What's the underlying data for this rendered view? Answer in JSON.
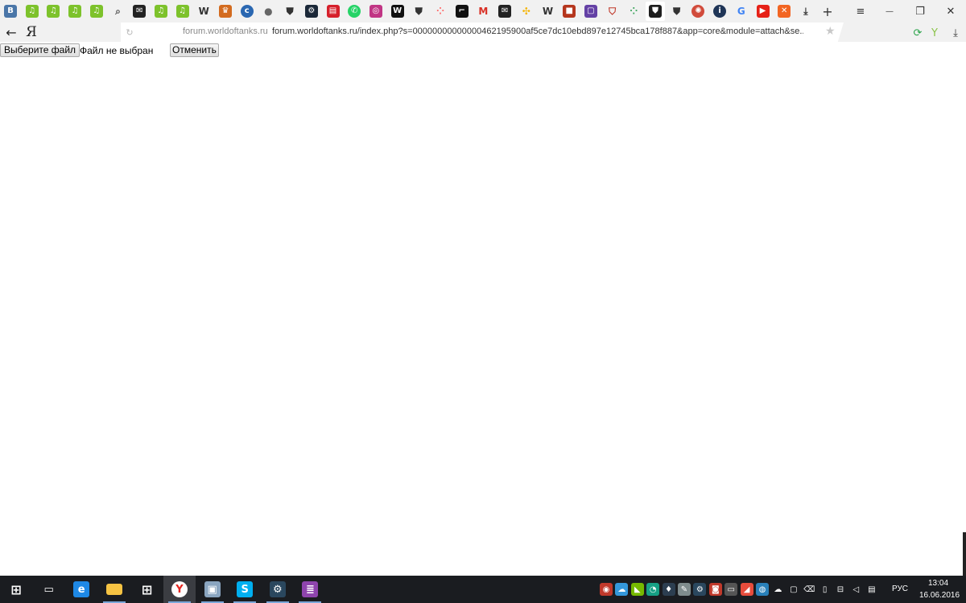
{
  "browser": {
    "tabs": [
      {
        "name": "tab-vk",
        "icon": "vk-icon",
        "glyph": "B",
        "color": "#4a76a8",
        "round": false
      },
      {
        "name": "tab-music-1",
        "icon": "music-note-icon",
        "glyph": "♫",
        "color": "#7dc22b",
        "round": false
      },
      {
        "name": "tab-music-2",
        "icon": "music-note-icon",
        "glyph": "♫",
        "color": "#7dc22b",
        "round": false
      },
      {
        "name": "tab-music-3",
        "icon": "music-note-icon",
        "glyph": "♫",
        "color": "#7dc22b",
        "round": false
      },
      {
        "name": "tab-music-4",
        "icon": "music-note-icon",
        "glyph": "♫",
        "color": "#7dc22b",
        "round": false
      },
      {
        "name": "tab-search",
        "icon": "search-icon",
        "glyph": "⌕",
        "color": "#555555",
        "plain": true
      },
      {
        "name": "tab-mail-1",
        "icon": "envelope-icon",
        "glyph": "✉",
        "color": "#222222",
        "round": false
      },
      {
        "name": "tab-music-5",
        "icon": "music-note-icon",
        "glyph": "♫",
        "color": "#7dc22b",
        "round": false
      },
      {
        "name": "tab-music-6",
        "icon": "music-note-icon",
        "glyph": "♫",
        "color": "#7dc22b",
        "round": false
      },
      {
        "name": "tab-wikipedia-1",
        "icon": "wikipedia-icon",
        "glyph": "W",
        "color": "#333333",
        "plain": true
      },
      {
        "name": "tab-game-shield",
        "icon": "shield-icon",
        "glyph": "♛",
        "color": "#d36b1f",
        "round": false
      },
      {
        "name": "tab-ct",
        "icon": "ct-icon",
        "glyph": "c",
        "color": "#2a67b1",
        "round": true
      },
      {
        "name": "tab-apple",
        "icon": "apple-icon",
        "glyph": "●",
        "color": "#666666",
        "plain": true
      },
      {
        "name": "tab-wot-1",
        "icon": "tank-icon",
        "glyph": "⛊",
        "color": "#333333",
        "plain": true
      },
      {
        "name": "tab-steam",
        "icon": "steam-icon",
        "glyph": "⚙",
        "color": "#1b2838",
        "round": false
      },
      {
        "name": "tab-red-logo",
        "icon": "video-icon",
        "glyph": "▤",
        "color": "#d6202b",
        "round": false
      },
      {
        "name": "tab-whatsapp",
        "icon": "whatsapp-icon",
        "glyph": "✆",
        "color": "#25d366",
        "round": true
      },
      {
        "name": "tab-instagram",
        "icon": "instagram-icon",
        "glyph": "◎",
        "color": "#c13584",
        "round": false
      },
      {
        "name": "tab-wikipedia-2",
        "icon": "wikipedia-icon",
        "glyph": "W",
        "color": "#111111",
        "round": false
      },
      {
        "name": "tab-wot-2",
        "icon": "tank-icon",
        "glyph": "⛊",
        "color": "#333333",
        "plain": true
      },
      {
        "name": "tab-dots",
        "icon": "dots-icon",
        "glyph": "⁘",
        "color": "#ff6b6b",
        "plain": true
      },
      {
        "name": "tab-dark-app",
        "icon": "app-icon",
        "glyph": "⌐",
        "color": "#111111",
        "round": false
      },
      {
        "name": "tab-gmail",
        "icon": "gmail-icon",
        "glyph": "M",
        "color": "#d93025",
        "plain": true
      },
      {
        "name": "tab-mail-2",
        "icon": "envelope-icon",
        "glyph": "✉",
        "color": "#222222",
        "round": false
      },
      {
        "name": "tab-photos",
        "icon": "pinwheel-icon",
        "glyph": "✣",
        "color": "#f4b400",
        "plain": true
      },
      {
        "name": "tab-wikipedia-3",
        "icon": "wikipedia-icon",
        "glyph": "W",
        "color": "#333333",
        "plain": true
      },
      {
        "name": "tab-red-square",
        "icon": "game-icon",
        "glyph": "■",
        "color": "#b5361d",
        "round": false
      },
      {
        "name": "tab-twitch",
        "icon": "twitch-icon",
        "glyph": "▢",
        "color": "#6441a5",
        "round": false
      },
      {
        "name": "tab-shield-red",
        "icon": "shield-icon",
        "glyph": "⛉",
        "color": "#c0392b",
        "plain": true
      },
      {
        "name": "tab-dots-2",
        "icon": "dots-icon",
        "glyph": "⁘",
        "color": "#3ba55c",
        "plain": true
      },
      {
        "name": "tab-wot-active",
        "icon": "tank-icon",
        "glyph": "⛊",
        "color": "#1e1e1e",
        "active": true
      },
      {
        "name": "tab-wot-3",
        "icon": "tank-icon",
        "glyph": "⛊",
        "color": "#333333",
        "plain": true
      },
      {
        "name": "tab-compass",
        "icon": "compass-icon",
        "glyph": "✺",
        "color": "#d14b3b",
        "round": true
      },
      {
        "name": "tab-info",
        "icon": "info-icon",
        "glyph": "i",
        "color": "#1f3557",
        "round": true
      },
      {
        "name": "tab-google",
        "icon": "google-icon",
        "glyph": "G",
        "color": "#4285f4",
        "plain": true
      },
      {
        "name": "tab-youtube",
        "icon": "youtube-icon",
        "glyph": "▶",
        "color": "#e62117",
        "round": false
      },
      {
        "name": "tab-orange",
        "icon": "pattern-icon",
        "glyph": "✕",
        "color": "#f26522",
        "round": false
      },
      {
        "name": "tab-download",
        "icon": "download-icon",
        "glyph": "⤓",
        "color": "#333333",
        "plain": true
      }
    ],
    "new_tab_glyph": "+",
    "menu_glyph": "≡",
    "minimize_glyph": "—",
    "restore_glyph": "❐",
    "close_glyph": "✕",
    "back_glyph": "←",
    "logo_glyph": "Я",
    "reload_glyph": "↻",
    "domain": "forum.worldoftanks.ru",
    "url": "forum.worldoftanks.ru/index.php?s=00000000000000462195900af5ce7dc10ebd897e12745bca178f887&app=core&module=attach&se...",
    "star_glyph": "★",
    "extensions": [
      {
        "name": "sync-icon",
        "glyph": "⟳",
        "color": "#2aa34a"
      },
      {
        "name": "sprout-icon",
        "glyph": "Y",
        "color": "#8bc34a"
      },
      {
        "name": "download-icon",
        "glyph": "⤓",
        "color": "#333333"
      }
    ]
  },
  "page": {
    "choose_file_label": "Выберите файл",
    "file_status": "Файл не выбран",
    "cancel_label": "Отменить"
  },
  "taskbar": {
    "apps": [
      {
        "name": "start-button",
        "icon": "windows-icon",
        "glyph": "⊞",
        "color": "transparent",
        "running": false
      },
      {
        "name": "task-view-button",
        "icon": "task-view-icon",
        "glyph": "▭",
        "color": "transparent",
        "running": false
      },
      {
        "name": "taskbar-edge",
        "icon": "edge-icon",
        "glyph": "e",
        "color": "#1e88e5",
        "running": false
      },
      {
        "name": "taskbar-explorer",
        "icon": "folder-icon",
        "glyph": "▬",
        "color": "#f6c343",
        "running": true
      },
      {
        "name": "taskbar-store",
        "icon": "store-icon",
        "glyph": "⊞",
        "color": "transparent",
        "running": false
      },
      {
        "name": "taskbar-yandex",
        "icon": "yandex-browser-icon",
        "glyph": "Y",
        "color": "#ffffff",
        "running": true,
        "active": true
      },
      {
        "name": "taskbar-app",
        "icon": "monitor-icon",
        "glyph": "▣",
        "color": "#8aa5c0",
        "running": true
      },
      {
        "name": "taskbar-skype",
        "icon": "skype-icon",
        "glyph": "S",
        "color": "#00aff0",
        "running": true
      },
      {
        "name": "taskbar-steam",
        "icon": "steam-icon",
        "glyph": "⚙",
        "color": "#2a475e",
        "running": true
      },
      {
        "name": "taskbar-winrar",
        "icon": "winrar-icon",
        "glyph": "≣",
        "color": "#8e44ad",
        "running": true
      }
    ],
    "tray": [
      {
        "name": "tray-game-icon",
        "glyph": "◉",
        "color": "#c0392b"
      },
      {
        "name": "tray-cloud-icon",
        "glyph": "☁",
        "color": "#3498db"
      },
      {
        "name": "tray-nvidia-icon",
        "glyph": "◣",
        "color": "#76b900"
      },
      {
        "name": "tray-circle-icon",
        "glyph": "◔",
        "color": "#16a085"
      },
      {
        "name": "tray-bolt-icon",
        "glyph": "♦",
        "color": "#2c3e50"
      },
      {
        "name": "tray-pen-icon",
        "glyph": "✎",
        "color": "#7f8c8d"
      },
      {
        "name": "tray-steam-icon",
        "glyph": "⚙",
        "color": "#2a475e"
      },
      {
        "name": "tray-red-icon",
        "glyph": "◙",
        "color": "#c0392b"
      },
      {
        "name": "tray-box-icon",
        "glyph": "▭",
        "color": "#555555"
      },
      {
        "name": "tray-amd-icon",
        "glyph": "◢",
        "color": "#e74c3c"
      },
      {
        "name": "tray-globe-icon",
        "glyph": "◍",
        "color": "#2980b9"
      },
      {
        "name": "tray-onedrive-icon",
        "glyph": "☁",
        "color": "#1a1c20"
      },
      {
        "name": "tray-window-icon",
        "glyph": "▢",
        "color": "#1a1c20"
      },
      {
        "name": "tray-remove-device-icon",
        "glyph": "⌫",
        "color": "#1a1c20"
      },
      {
        "name": "tray-battery-icon",
        "glyph": "▯",
        "color": "#1a1c20"
      },
      {
        "name": "tray-network-icon",
        "glyph": "⊟",
        "color": "#1a1c20"
      },
      {
        "name": "tray-volume-icon",
        "glyph": "◁",
        "color": "#1a1c20"
      },
      {
        "name": "tray-notifications-icon",
        "glyph": "▤",
        "color": "#1a1c20"
      }
    ],
    "language": "РУС",
    "time": "13:04",
    "date": "16.06.2016"
  }
}
